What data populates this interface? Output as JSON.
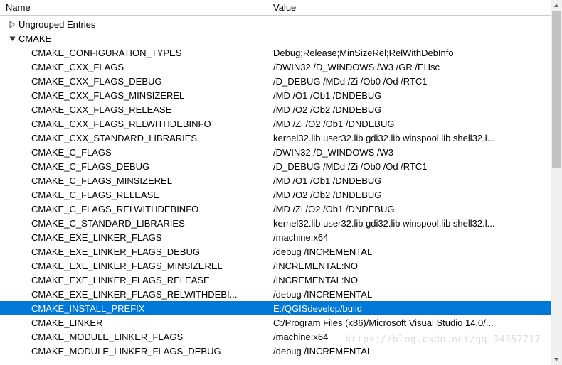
{
  "columns": {
    "name": "Name",
    "value": "Value"
  },
  "groups": {
    "ungrouped": {
      "label": "Ungrouped Entries",
      "expanded": false
    },
    "cmake": {
      "label": "CMAKE",
      "expanded": true
    }
  },
  "selected_key": "CMAKE_INSTALL_PREFIX",
  "entries": [
    {
      "name": "CMAKE_CONFIGURATION_TYPES",
      "value": "Debug;Release;MinSizeRel;RelWithDebInfo"
    },
    {
      "name": "CMAKE_CXX_FLAGS",
      "value": "/DWIN32 /D_WINDOWS /W3 /GR /EHsc"
    },
    {
      "name": "CMAKE_CXX_FLAGS_DEBUG",
      "value": "/D_DEBUG /MDd /Zi /Ob0 /Od /RTC1"
    },
    {
      "name": "CMAKE_CXX_FLAGS_MINSIZEREL",
      "value": "/MD /O1 /Ob1 /DNDEBUG"
    },
    {
      "name": "CMAKE_CXX_FLAGS_RELEASE",
      "value": "/MD /O2 /Ob2 /DNDEBUG"
    },
    {
      "name": "CMAKE_CXX_FLAGS_RELWITHDEBINFO",
      "value": "/MD /Zi /O2 /Ob1 /DNDEBUG"
    },
    {
      "name": "CMAKE_CXX_STANDARD_LIBRARIES",
      "value": "kernel32.lib user32.lib gdi32.lib winspool.lib shell32.l..."
    },
    {
      "name": "CMAKE_C_FLAGS",
      "value": "/DWIN32 /D_WINDOWS /W3"
    },
    {
      "name": "CMAKE_C_FLAGS_DEBUG",
      "value": "/D_DEBUG /MDd /Zi /Ob0 /Od /RTC1"
    },
    {
      "name": "CMAKE_C_FLAGS_MINSIZEREL",
      "value": "/MD /O1 /Ob1 /DNDEBUG"
    },
    {
      "name": "CMAKE_C_FLAGS_RELEASE",
      "value": "/MD /O2 /Ob2 /DNDEBUG"
    },
    {
      "name": "CMAKE_C_FLAGS_RELWITHDEBINFO",
      "value": "/MD /Zi /O2 /Ob1 /DNDEBUG"
    },
    {
      "name": "CMAKE_C_STANDARD_LIBRARIES",
      "value": "kernel32.lib user32.lib gdi32.lib winspool.lib shell32.l..."
    },
    {
      "name": "CMAKE_EXE_LINKER_FLAGS",
      "value": "/machine:x64"
    },
    {
      "name": "CMAKE_EXE_LINKER_FLAGS_DEBUG",
      "value": "/debug /INCREMENTAL"
    },
    {
      "name": "CMAKE_EXE_LINKER_FLAGS_MINSIZEREL",
      "value": "/INCREMENTAL:NO"
    },
    {
      "name": "CMAKE_EXE_LINKER_FLAGS_RELEASE",
      "value": "/INCREMENTAL:NO"
    },
    {
      "name": "CMAKE_EXE_LINKER_FLAGS_RELWITHDEBI...",
      "value": "/debug /INCREMENTAL"
    },
    {
      "name": "CMAKE_INSTALL_PREFIX",
      "value": "E:/QGISdevelop/bulid"
    },
    {
      "name": "CMAKE_LINKER",
      "value": "C:/Program Files (x86)/Microsoft Visual Studio 14.0/..."
    },
    {
      "name": "CMAKE_MODULE_LINKER_FLAGS",
      "value": "/machine:x64"
    },
    {
      "name": "CMAKE_MODULE_LINKER_FLAGS_DEBUG",
      "value": "/debug /INCREMENTAL"
    }
  ],
  "watermark": "https://blog.csdn.net/qq_34357717"
}
